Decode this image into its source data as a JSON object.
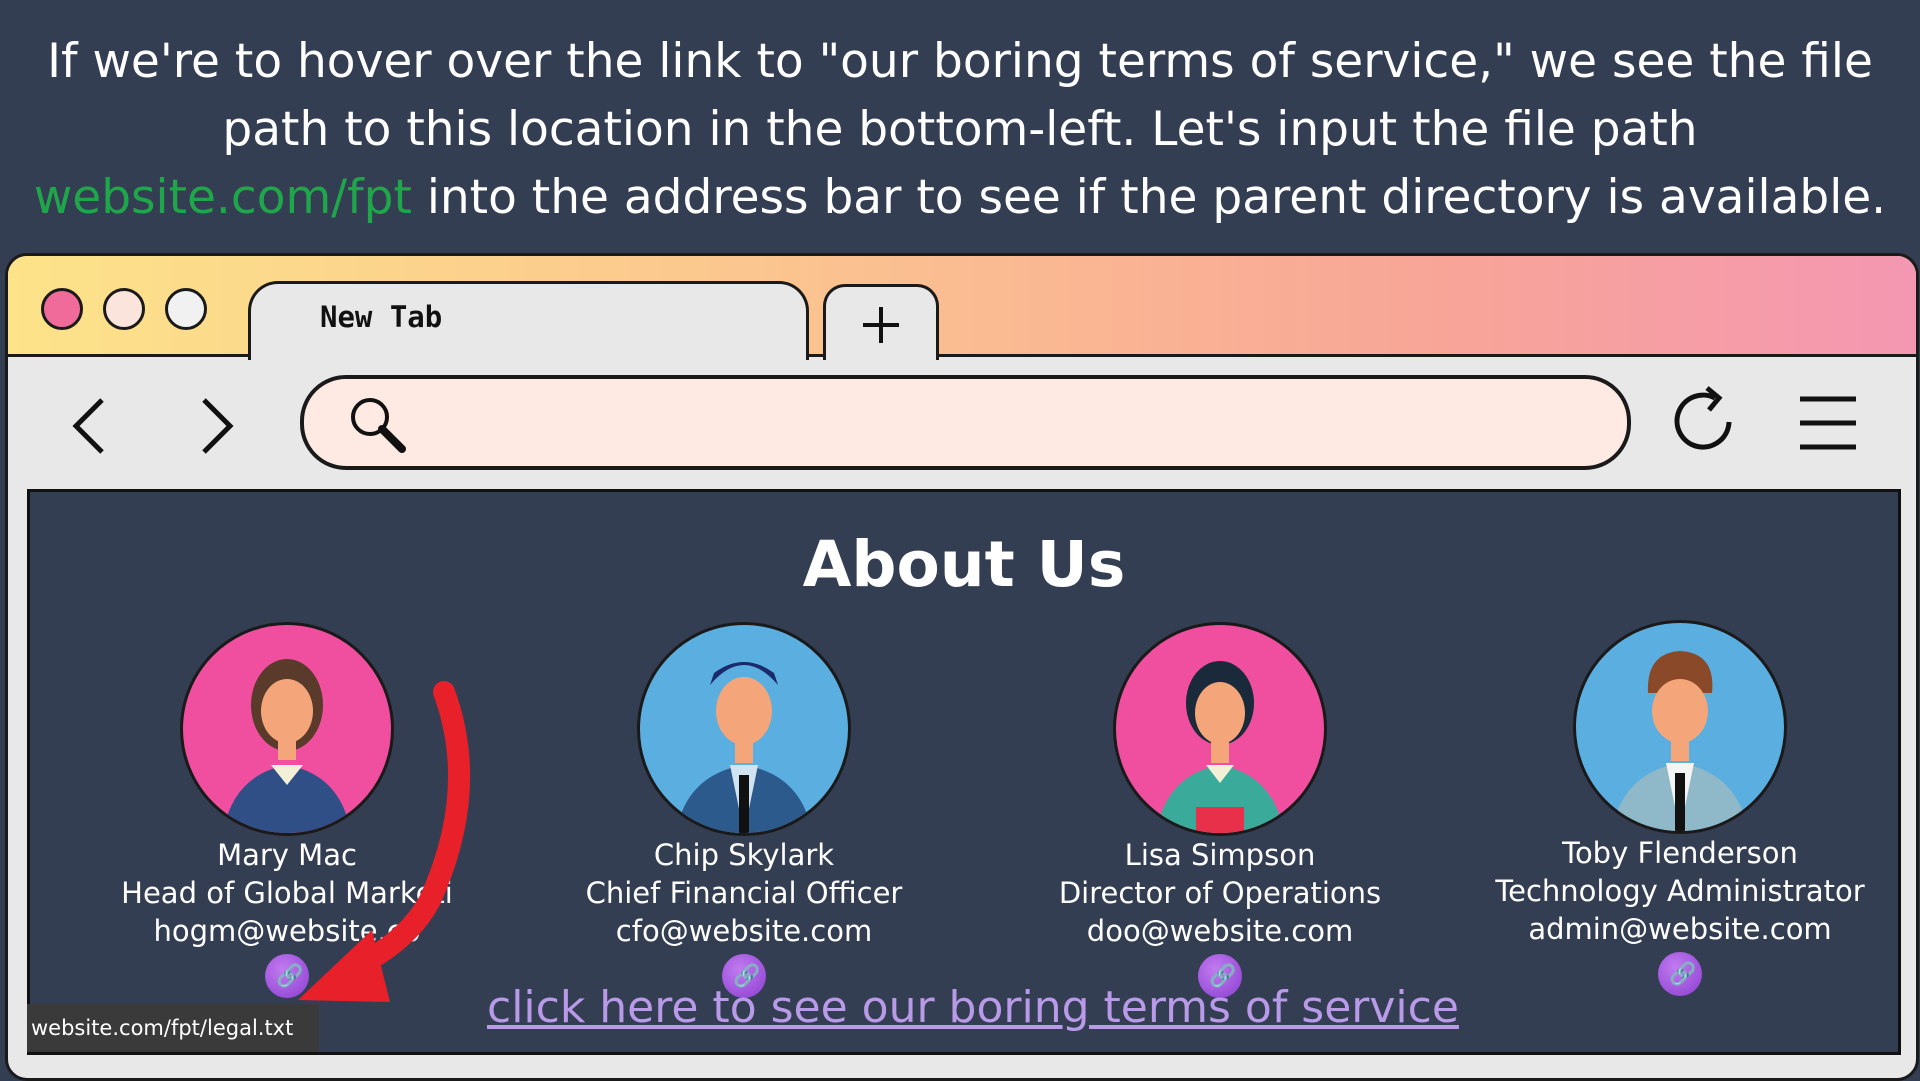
{
  "caption": {
    "line1": "If we're to hover over the link to \"our boring terms of service,\" we see the file",
    "line2": "path to this location in the bottom-left. Let's input the file path",
    "highlight": "website.com/fpt",
    "line3_rest": " into the address bar to see if the parent directory is available."
  },
  "browser": {
    "tab_label": "New Tab",
    "address_value": ""
  },
  "page": {
    "title": "About Us",
    "team": [
      {
        "name": "Mary Mac",
        "role": "Head of Global Marketi",
        "email": "hogm@website.co"
      },
      {
        "name": "Chip Skylark",
        "role": "Chief Financial Officer",
        "email": "cfo@website.com"
      },
      {
        "name": "Lisa Simpson",
        "role": "Director of Operations",
        "email": "doo@website.com"
      },
      {
        "name": "Toby Flenderson",
        "role": "Technology Administrator",
        "email": "admin@website.com"
      }
    ],
    "tos_link": "click here to see our boring terms of service",
    "status_url": "website.com/fpt/legal.txt"
  },
  "colors": {
    "background": "#343e52",
    "highlight": "#1fa64a",
    "link": "#b99ae8",
    "arrow": "#e8202a",
    "avatar_pink": "#f04fa0",
    "avatar_blue": "#5aaee0"
  }
}
